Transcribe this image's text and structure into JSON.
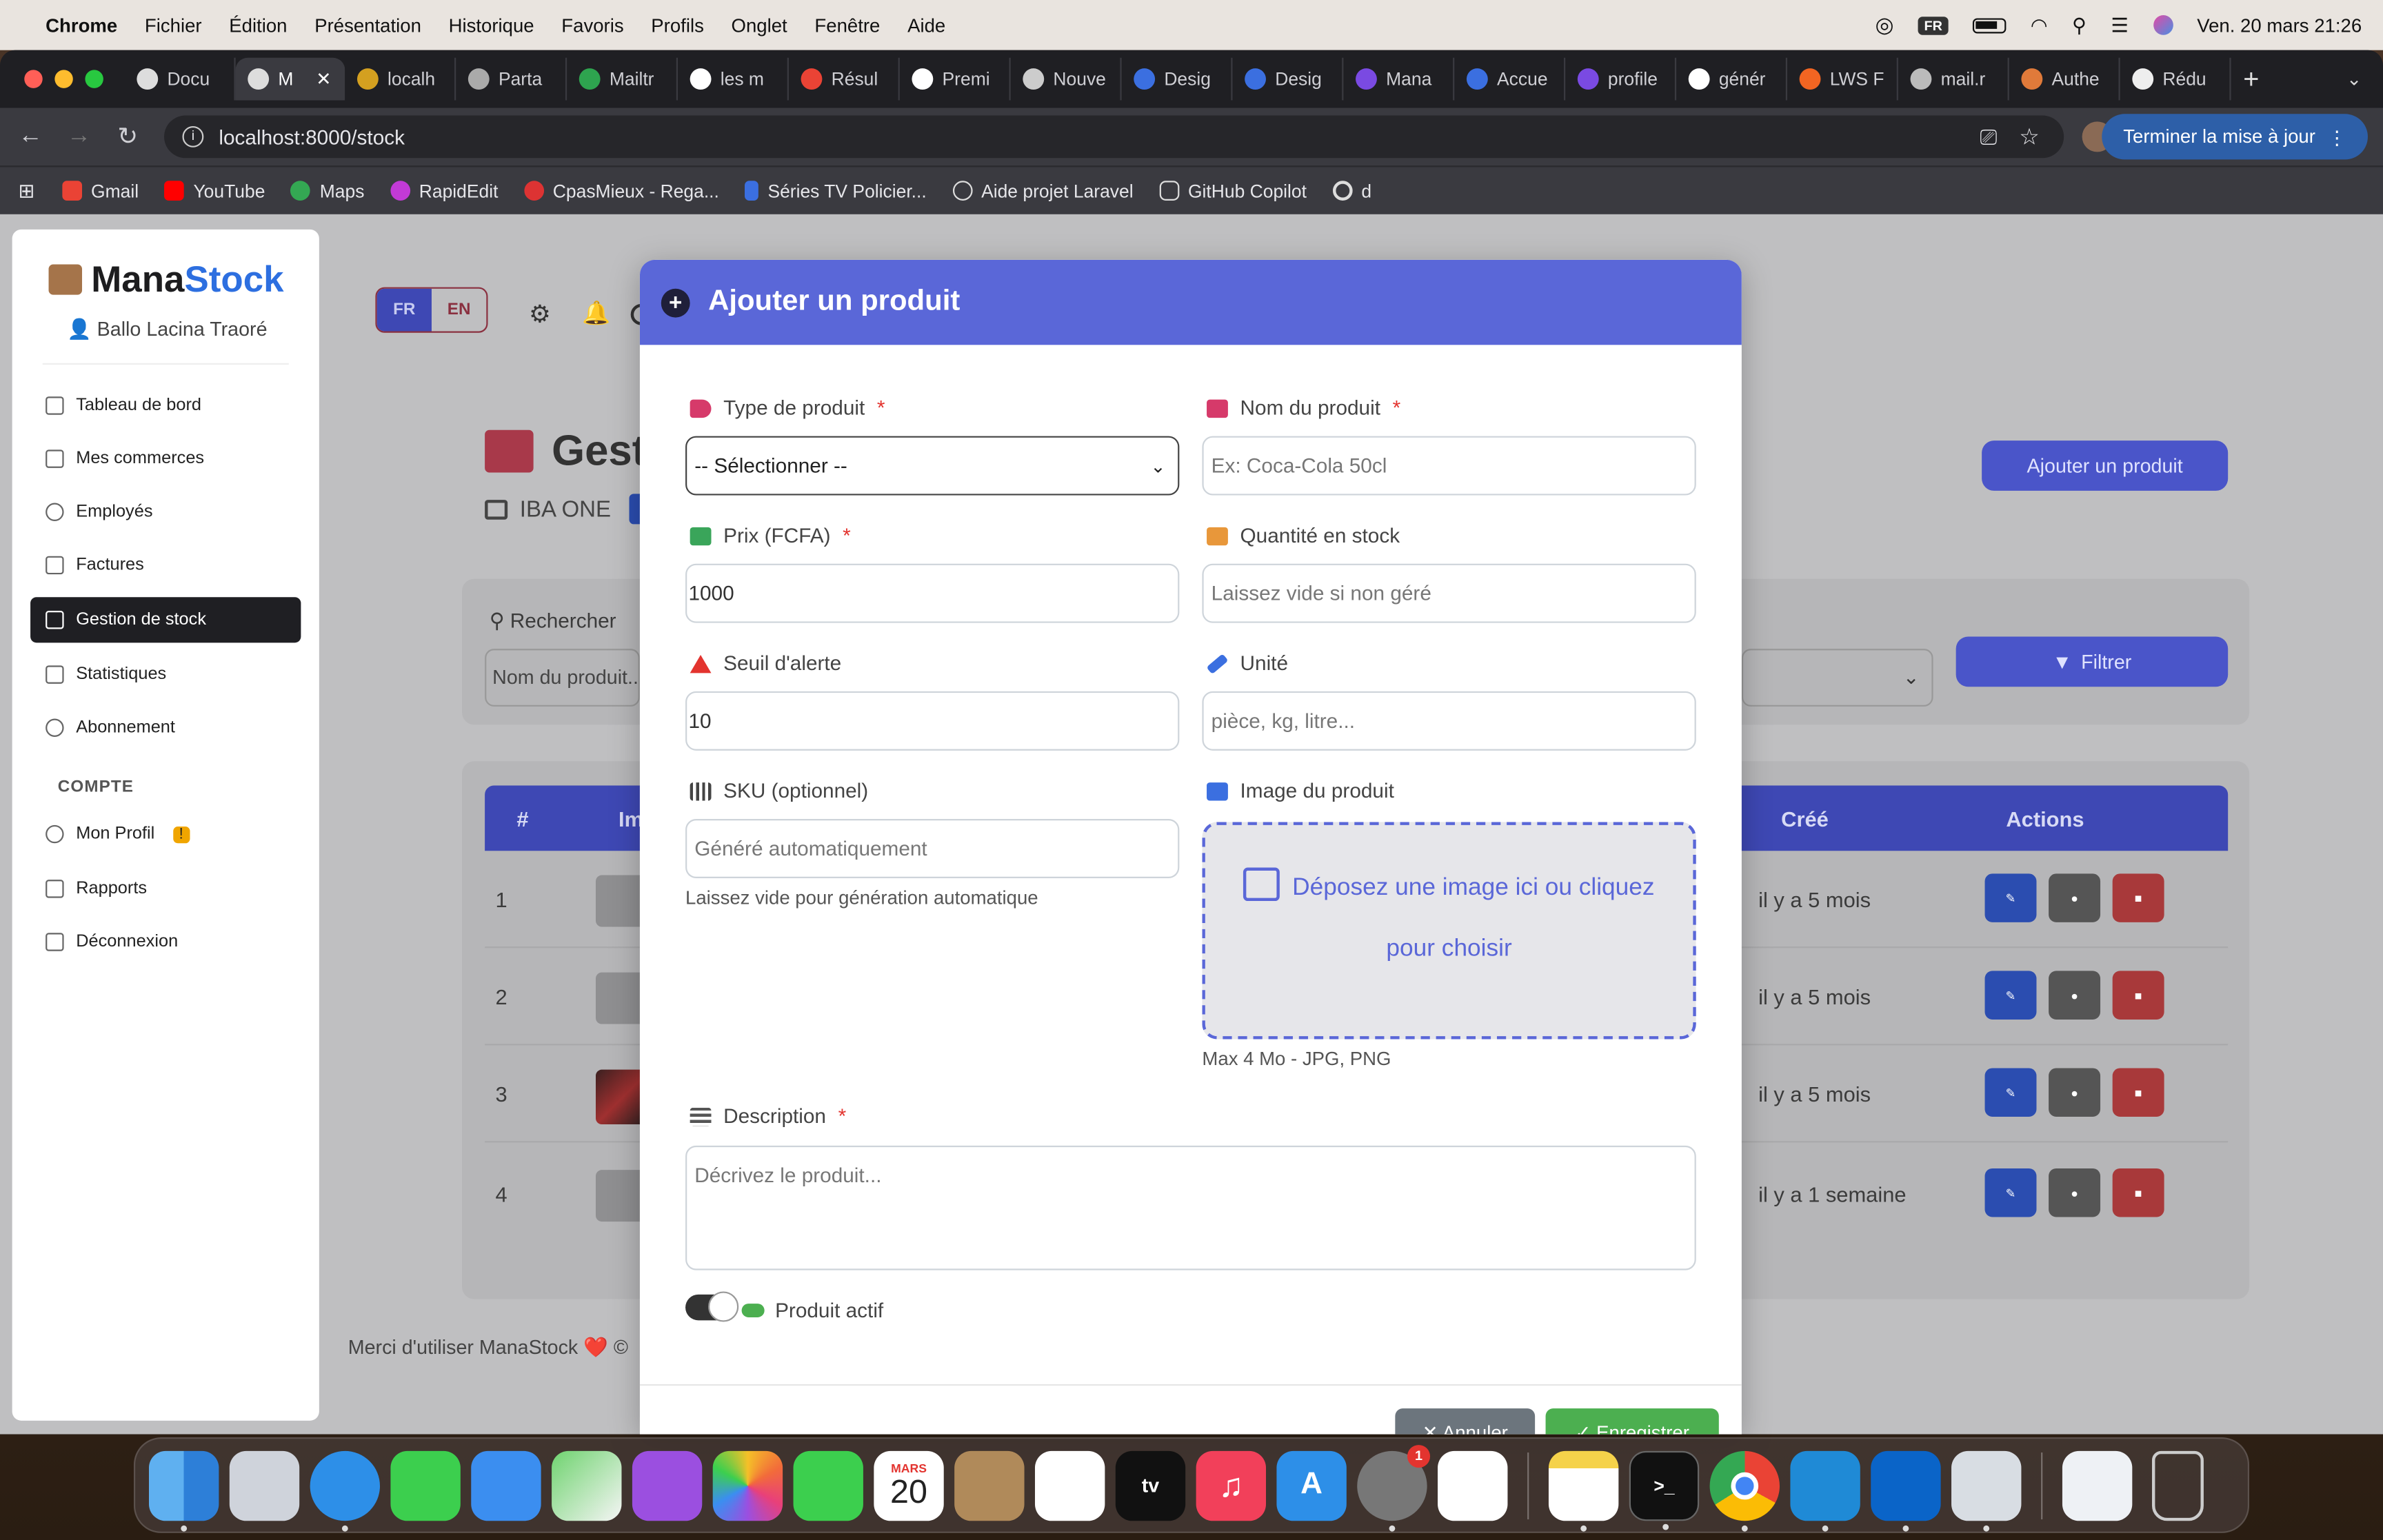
{
  "menubar": {
    "app": "Chrome",
    "items": [
      "Fichier",
      "Édition",
      "Présentation",
      "Historique",
      "Favoris",
      "Profils",
      "Onglet",
      "Fenêtre",
      "Aide"
    ],
    "input_source": "FR",
    "datetime": "Ven. 20 mars  21:26"
  },
  "tabs": [
    "Docu",
    "M",
    "localh",
    "Parta",
    "Mailtr",
    "les m",
    "Résul",
    "Premi",
    "Nouve",
    "Desig",
    "Desig",
    "Mana",
    "Accue",
    "profile",
    "génér",
    "LWS F",
    "mail.r",
    "Authe",
    "Rédu"
  ],
  "toolbar": {
    "url": "localhost:8000/stock",
    "update_label": "Terminer la mise à jour"
  },
  "bookmarks": [
    "Gmail",
    "YouTube",
    "Maps",
    "RapidEdit",
    "CpasMieux - Rega...",
    "Séries TV Policier...",
    "Aide projet Laravel",
    "GitHub Copilot",
    "d"
  ],
  "sidebar": {
    "logo_prefix": "Mana",
    "logo_suffix": "Stock",
    "user": "Ballo Lacina Traoré",
    "items": [
      {
        "label": "Tableau de bord"
      },
      {
        "label": "Mes commerces"
      },
      {
        "label": "Employés"
      },
      {
        "label": "Factures"
      },
      {
        "label": "Gestion de stock"
      },
      {
        "label": "Statistiques"
      },
      {
        "label": "Abonnement"
      }
    ],
    "section": "COMPTE",
    "account_items": [
      {
        "label": "Mon Profil"
      },
      {
        "label": "Rapports"
      },
      {
        "label": "Déconnexion"
      }
    ],
    "profile_badge": "!"
  },
  "background": {
    "lang_fr": "FR",
    "lang_en": "EN",
    "page_title": "Gest",
    "shop_name": "IBA ONE",
    "add_button": "Ajouter un produit",
    "search_label": "Rechercher",
    "search_placeholder": "Nom du produit...",
    "filter_button": "Filtrer",
    "col_num": "#",
    "col_image": "Im",
    "col_created": "Créé",
    "col_actions": "Actions",
    "rows": [
      {
        "num": "1",
        "created": "il y a 5 mois"
      },
      {
        "num": "2",
        "created": "il y a 5 mois"
      },
      {
        "num": "3",
        "created": "il y a 5 mois"
      },
      {
        "num": "4",
        "created": "il y a 1 semaine"
      }
    ],
    "footer": "Merci d'utiliser ManaStock ❤️ ©"
  },
  "modal": {
    "title": "Ajouter un produit",
    "type_label": "Type de produit",
    "type_value": "-- Sélectionner --",
    "name_label": "Nom du produit",
    "name_placeholder": "Ex: Coca-Cola 50cl",
    "price_label": "Prix (FCFA)",
    "price_value": "1000",
    "qty_label": "Quantité en stock",
    "qty_placeholder": "Laissez vide si non géré",
    "alert_label": "Seuil d'alerte",
    "alert_value": "10",
    "unit_label": "Unité",
    "unit_placeholder": "pièce, kg, litre...",
    "sku_label": "SKU (optionnel)",
    "sku_placeholder": "Généré automatiquement",
    "sku_hint": "Laissez vide pour génération automatique",
    "image_label": "Image du produit",
    "image_drop_line1": "Déposez une image ici ou cliquez",
    "image_drop_line2": "pour choisir",
    "image_hint": "Max 4 Mo - JPG, PNG",
    "desc_label": "Description",
    "desc_placeholder": "Décrivez le produit...",
    "active_label": "Produit actif",
    "required_mark": "*",
    "cancel": "✕ Annuler",
    "save": "✓ Enregistrer"
  },
  "dock": {
    "calendar_month": "MARS",
    "calendar_day": "20",
    "settings_badge": "1",
    "tv_label": "tv"
  },
  "colors": {
    "primary": "#5a67d8",
    "danger": "#e3342f",
    "success": "#4caf50",
    "dark": "#1f1f23"
  }
}
